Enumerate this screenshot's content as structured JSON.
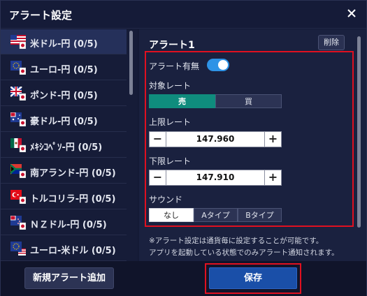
{
  "dialog": {
    "title": "アラート設定",
    "close_icon": "close-icon"
  },
  "sidebar": {
    "items": [
      {
        "label": "米ドル-円 (0/5)",
        "flag": "us-jp-flag-icon",
        "active": true
      },
      {
        "label": "ユーロ-円 (0/5)",
        "flag": "eu-jp-flag-icon",
        "active": false
      },
      {
        "label": "ポンド-円 (0/5)",
        "flag": "gb-jp-flag-icon",
        "active": false
      },
      {
        "label": "豪ドル-円 (0/5)",
        "flag": "au-jp-flag-icon",
        "active": false
      },
      {
        "label": "ﾒｷｼｺﾍﾟｿ-円 (0/5)",
        "flag": "mx-jp-flag-icon",
        "active": false
      },
      {
        "label": "南アランド-円 (0/5)",
        "flag": "za-jp-flag-icon",
        "active": false
      },
      {
        "label": "トルコリラ-円 (0/5)",
        "flag": "tr-jp-flag-icon",
        "active": false
      },
      {
        "label": "ＮＺドル-円 (0/5)",
        "flag": "nz-jp-flag-icon",
        "active": false
      },
      {
        "label": "ユーロ-米ドル (0/5)",
        "flag": "eu-us-flag-icon",
        "active": false
      }
    ]
  },
  "alert": {
    "title": "アラート1",
    "delete_label": "削除",
    "enabled_label": "アラート有無",
    "enabled": true,
    "rate_label": "対象レート",
    "rate_options": [
      "売",
      "買"
    ],
    "rate_selected": "売",
    "upper_label": "上限レート",
    "upper_value": "147.960",
    "lower_label": "下限レート",
    "lower_value": "147.910",
    "minus_glyph": "−",
    "plus_glyph": "+",
    "sound_label": "サウンド",
    "sound_options": [
      "なし",
      "Aタイプ",
      "Bタイプ"
    ],
    "sound_selected": "なし"
  },
  "notes": [
    "※アラート設定は通貨毎に設定することが可能です。",
    "アプリを起動している状態でのみアラート通知されます。"
  ],
  "footer": {
    "add_label": "新規アラート追加",
    "save_label": "保存"
  },
  "colors": {
    "accent": "#2e93e6",
    "sell_active": "#0f8c7d",
    "highlight": "#e01020",
    "save": "#1a4fa8"
  }
}
